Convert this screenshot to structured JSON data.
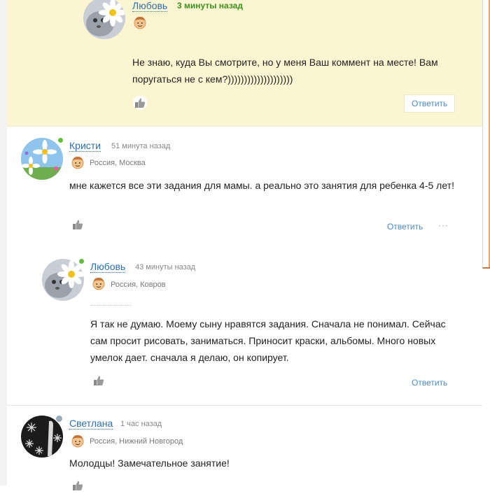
{
  "comments": [
    {
      "author": "Любовь",
      "time": "3 минуты назад",
      "text": "Не знаю, куда Вы смотрите, но у меня Ваш коммент на месте! Вам поругаться не с кем?))))))))))))))))))))",
      "reply_label": "Ответить"
    },
    {
      "author": "Кристи",
      "time": "51 минута назад",
      "location": "Россия, Москва",
      "text": "мне кажется все эти задания для мамы. а реально это занятия для ребенка 4-5 лет!",
      "reply_label": "Ответить",
      "more_label": "···"
    },
    {
      "author": "Любовь",
      "time": "43 минуты назад",
      "location": "Россия, Ковров",
      "text": "Я так не думаю. Моему сыну нравятся задания. Сначала не понимал. Сейчас сам просит рисовать, заниматься. Приносит краски, альбомы. Много новых умелок дает. сначала я делаю, он копирует.",
      "reply_label": "Ответить"
    },
    {
      "author": "Светлана",
      "time": "1 час назад",
      "location": "Россия, Нижний Новгород",
      "text": "Молодцы! Замечательное занятие!"
    }
  ],
  "colors": {
    "highlight_bg": "#fcf5d2",
    "link": "#2a6fb5",
    "online": "#5fbf3b",
    "accent": "#e9a35c"
  },
  "icons": [
    "daisy-cat-avatar",
    "daisy-sky-avatar",
    "snowflake-dark-avatar",
    "smiley-face-icon",
    "thumbs-up-icon",
    "online-dot",
    "clock-icon"
  ]
}
